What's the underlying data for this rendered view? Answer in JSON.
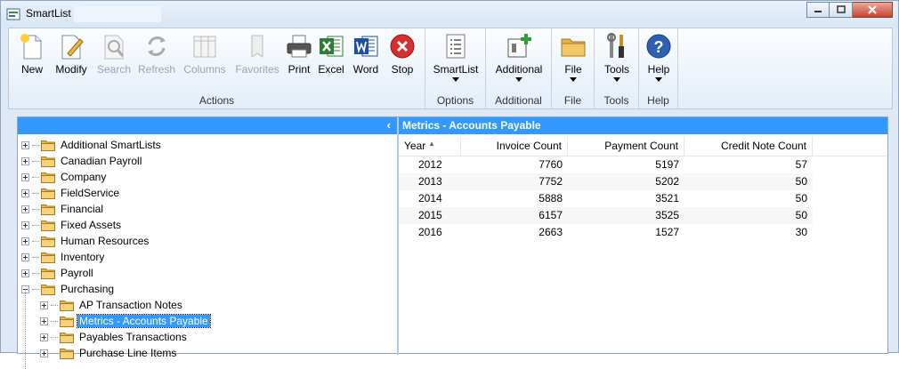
{
  "window": {
    "title": "SmartList"
  },
  "ribbon": {
    "actions": {
      "title": "Actions",
      "buttons": [
        {
          "label": "New",
          "icon": "new-icon",
          "disabled": false
        },
        {
          "label": "Modify",
          "icon": "modify-icon",
          "disabled": false
        },
        {
          "label": "Search",
          "icon": "search-icon",
          "disabled": true
        },
        {
          "label": "Refresh",
          "icon": "refresh-icon",
          "disabled": true
        },
        {
          "label": "Columns",
          "icon": "columns-icon",
          "disabled": true
        },
        {
          "label": "Favorites",
          "icon": "favorites-icon",
          "disabled": true
        },
        {
          "label": "Print",
          "icon": "print-icon",
          "disabled": false
        },
        {
          "label": "Excel",
          "icon": "excel-icon",
          "disabled": false
        },
        {
          "label": "Word",
          "icon": "word-icon",
          "disabled": false
        },
        {
          "label": "Stop",
          "icon": "stop-icon",
          "disabled": false
        }
      ]
    },
    "options": {
      "title": "Options",
      "button": "SmartList"
    },
    "additional": {
      "title": "Additional",
      "button": "Additional"
    },
    "file": {
      "title": "File",
      "button": "File"
    },
    "tools": {
      "title": "Tools",
      "button": "Tools"
    },
    "help": {
      "title": "Help",
      "button": "Help"
    }
  },
  "left_pane": {
    "collapse_glyph": "‹",
    "tree": [
      {
        "label": "Additional SmartLists",
        "level": 0,
        "expanded": false
      },
      {
        "label": "Canadian Payroll",
        "level": 0,
        "expanded": false
      },
      {
        "label": "Company",
        "level": 0,
        "expanded": false
      },
      {
        "label": "FieldService",
        "level": 0,
        "expanded": false
      },
      {
        "label": "Financial",
        "level": 0,
        "expanded": false
      },
      {
        "label": "Fixed Assets",
        "level": 0,
        "expanded": false
      },
      {
        "label": "Human Resources",
        "level": 0,
        "expanded": false
      },
      {
        "label": "Inventory",
        "level": 0,
        "expanded": false
      },
      {
        "label": "Payroll",
        "level": 0,
        "expanded": false
      },
      {
        "label": "Purchasing",
        "level": 0,
        "expanded": true
      },
      {
        "label": "AP Transaction Notes",
        "level": 1,
        "expanded": false
      },
      {
        "label": "Metrics - Accounts Payable",
        "level": 1,
        "expanded": false,
        "selected": true
      },
      {
        "label": "Payables Transactions",
        "level": 1,
        "expanded": false
      },
      {
        "label": "Purchase Line Items",
        "level": 1,
        "expanded": false
      }
    ]
  },
  "right_pane": {
    "title": "Metrics - Accounts Payable",
    "columns": [
      "Year",
      "Invoice Count",
      "Payment Count",
      "Credit Note Count"
    ],
    "rows": [
      [
        "2012",
        "7760",
        "5197",
        "57"
      ],
      [
        "2013",
        "7752",
        "5202",
        "50"
      ],
      [
        "2014",
        "5888",
        "3521",
        "50"
      ],
      [
        "2015",
        "6157",
        "3525",
        "50"
      ],
      [
        "2016",
        "2663",
        "1527",
        "30"
      ]
    ]
  },
  "colors": {
    "accent": "#3399ff",
    "ribbon_bg": "#e3edf8",
    "frame": "#dfe9f5"
  }
}
